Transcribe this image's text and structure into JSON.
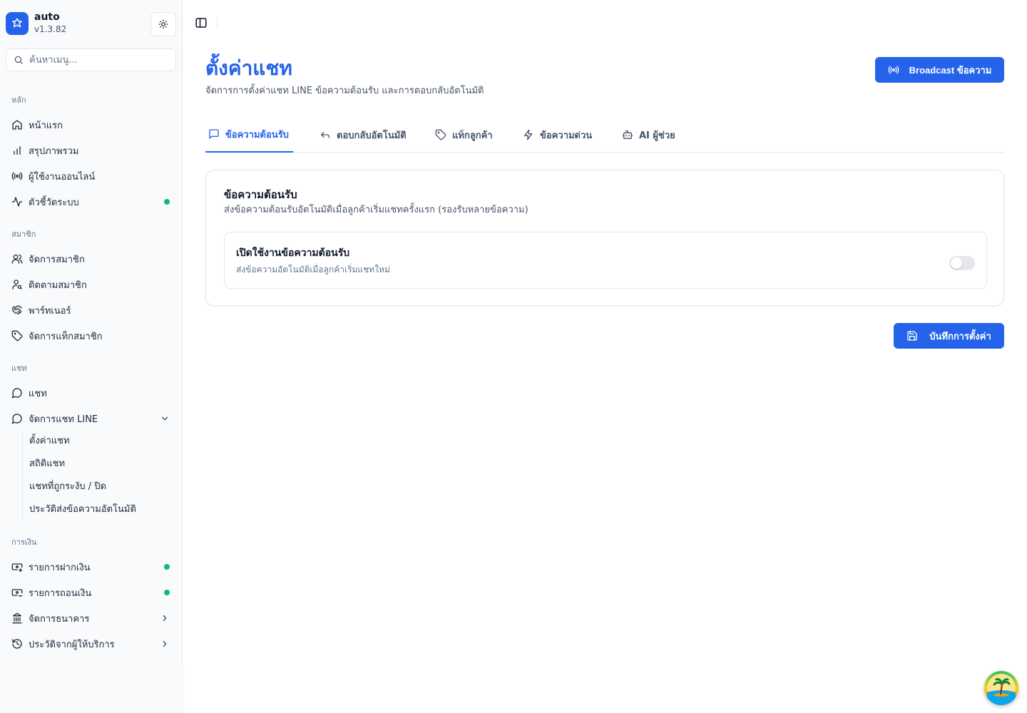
{
  "app": {
    "name": "auto",
    "version": "v1.3.82"
  },
  "search": {
    "placeholder": "ค้นหาเมนู..."
  },
  "sidebar": {
    "groups": {
      "main": "หลัก",
      "members": "สมาชิก",
      "chat": "แชท",
      "finance": "การเงิน"
    },
    "items": {
      "home": "หน้าแรก",
      "overview": "สรุปภาพรวม",
      "online_users": "ผู้ใช้งานออนไลน์",
      "system_metrics": "ตัวชี้วัดระบบ",
      "manage_members": "จัดการสมาชิก",
      "track_members": "ติดตามสมาชิก",
      "partners": "พาร์ทเนอร์",
      "member_tags": "จัดการแท็กสมาชิก",
      "chat": "แชท",
      "line_chat": "จัดการแชท LINE",
      "deposits": "รายการฝากเงิน",
      "withdrawals": "รายการถอนเงิน",
      "banks": "จัดการธนาคาร",
      "provider_history": "ประวัติจากผู้ให้บริการ"
    },
    "line_sub": {
      "settings": "ตั้งค่าแชท",
      "stats": "สถิติแชท",
      "blocked": "แชทที่ถูกระงับ / ปิด",
      "auto_history": "ประวัติส่งข้อความอัตโนมัติ"
    }
  },
  "page": {
    "title": "ตั้งค่าแชท",
    "subtitle": "จัดการการตั้งค่าแชท LINE ข้อความต้อนรับ และการตอบกลับอัตโนมัติ",
    "broadcast_label": "Broadcast ข้อความ"
  },
  "tabs": {
    "welcome": "ข้อความต้อนรับ",
    "auto_reply": "ตอบกลับอัตโนมัติ",
    "customer_tags": "แท็กลูกค้า",
    "quick_messages": "ข้อความด่วน",
    "ai_assistant": "AI ผู้ช่วย"
  },
  "card": {
    "title": "ข้อความต้อนรับ",
    "description": "ส่งข้อความต้อนรับอัตโนมัติเมื่อลูกค้าเริ่มแชทครั้งแรก (รองรับหลายข้อความ)",
    "toggle_title": "เปิดใช้งานข้อความต้อนรับ",
    "toggle_description": "ส่งข้อความอัตโนมัติเมื่อลูกค้าเริ่มแชทใหม่",
    "toggle_enabled": false
  },
  "save_label": "บันทึกการตั้งค่า",
  "colors": {
    "accent": "#2563eb",
    "online_dot": "#10b981"
  }
}
